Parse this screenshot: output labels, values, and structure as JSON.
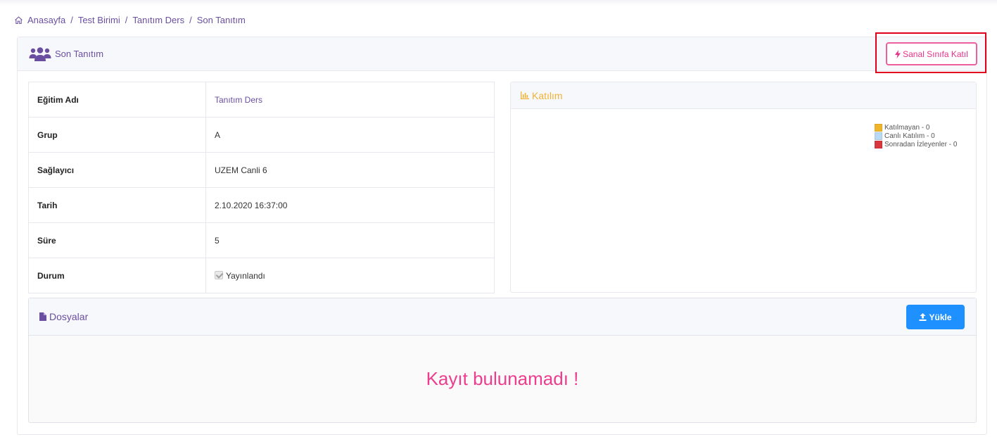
{
  "breadcrumb": {
    "items": [
      "Anasayfa",
      "Test Birimi",
      "Tanıtım Ders",
      "Son Tanıtım"
    ],
    "separator": "/"
  },
  "main": {
    "title": "Son Tanıtım",
    "join_button": "Sanal Sınıfa Katıl"
  },
  "details": [
    {
      "label": "Eğitim Adı",
      "value": "Tanıtım Ders"
    },
    {
      "label": "Grup",
      "value": "A"
    },
    {
      "label": "Sağlayıcı",
      "value": "UZEM Canli 6"
    },
    {
      "label": "Tarih",
      "value": "2.10.2020 16:37:00"
    },
    {
      "label": "Süre",
      "value": "5"
    },
    {
      "label": "Durum",
      "value": "Yayınlandı",
      "checked": true
    }
  ],
  "chart": {
    "title": "Katılım",
    "legend": [
      {
        "label": "Katılmayan - 0",
        "color": "#f0b429"
      },
      {
        "label": "Canlı Katılım - 0",
        "color": "#b8d8f4"
      },
      {
        "label": "Sonradan İzleyenler - 0",
        "color": "#d9363e"
      }
    ]
  },
  "files": {
    "title": "Dosyalar",
    "upload_button": "Yükle",
    "empty_message": "Kayıt bulunamadı !"
  },
  "colors": {
    "accent": "#6a4fa1",
    "pink": "#ec3d8f",
    "blue": "#1e90ff",
    "highlight": "#e0001b",
    "chart_title": "#f2b233"
  }
}
